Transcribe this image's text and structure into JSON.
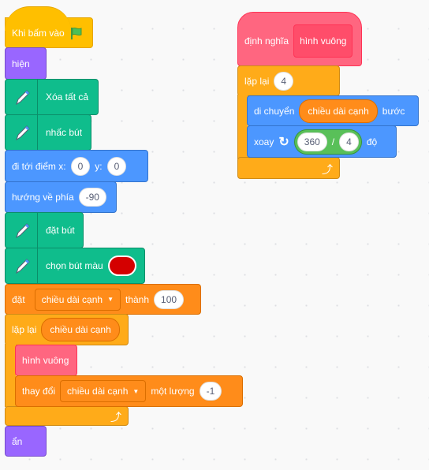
{
  "colors": {
    "events": "#FFBF00",
    "looks": "#9966FF",
    "pen": "#0FBD8C",
    "motion": "#4C97FF",
    "variables": "#FF8C1A",
    "control": "#FFAB19",
    "custom": "#FF6680",
    "operators": "#59C059",
    "pen_color_value": "#D40000"
  },
  "main_script": {
    "hat": {
      "label": "Khi bấm vào",
      "icon": "green-flag-icon"
    },
    "show": "hiện",
    "clear": "Xóa tất cả",
    "pen_up": "nhấc bút",
    "goto": {
      "label": "đi tới điểm x:",
      "x": "0",
      "y_label": "y:",
      "y": "0"
    },
    "point": {
      "label": "hướng về phía",
      "value": "-90"
    },
    "pen_down": "đặt bút",
    "set_color": {
      "label": "chọn bút màu"
    },
    "set_var": {
      "label": "đặt",
      "variable": "chiều dài cạnh",
      "to_label": "thành",
      "value": "100"
    },
    "repeat": {
      "label": "lặp lại",
      "reporter": "chiều dài cạnh",
      "call": "hình vuông",
      "change": {
        "label": "thay đổi",
        "variable": "chiều dài cạnh",
        "by_label": "một lượng",
        "value": "-1"
      }
    },
    "hide": "ẩn"
  },
  "define_script": {
    "define": {
      "label": "định nghĩa",
      "name": "hình vuông"
    },
    "repeat": {
      "label": "lặp lại",
      "times": "4",
      "move": {
        "label": "di chuyển",
        "reporter": "chiều dài cạnh",
        "unit": "bước"
      },
      "turn": {
        "label": "xoay",
        "a": "360",
        "op": "/",
        "b": "4",
        "unit": "độ"
      }
    }
  }
}
